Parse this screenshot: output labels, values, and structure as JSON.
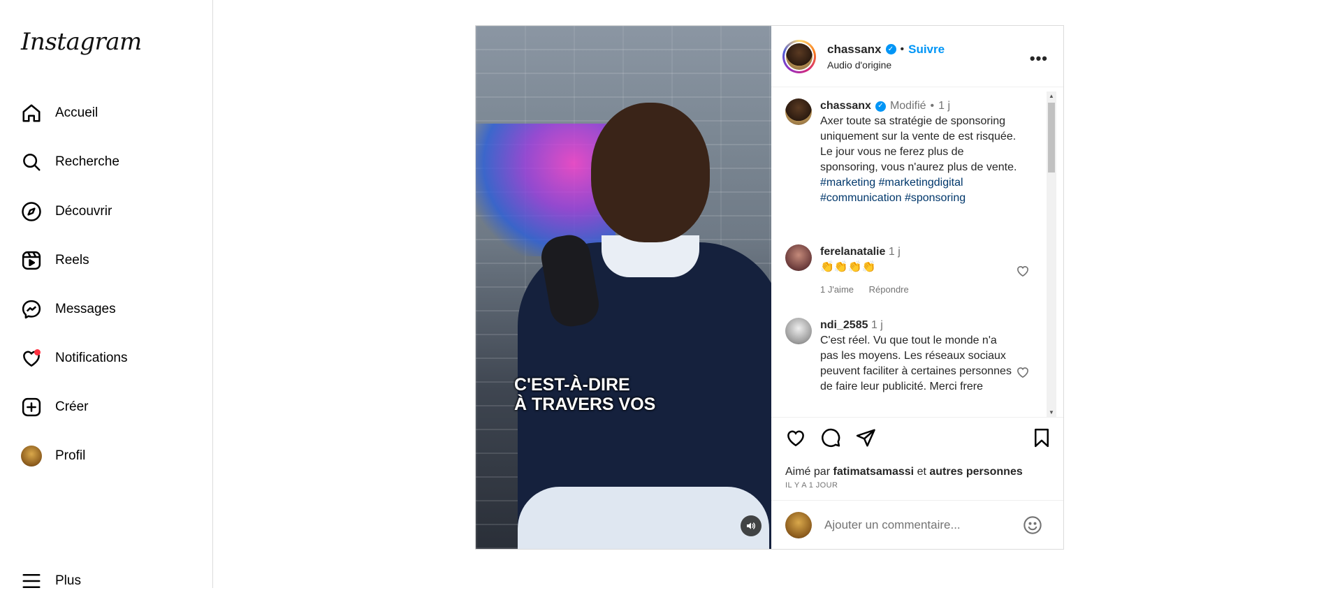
{
  "brand": {
    "logo_text": "Instagram"
  },
  "sidebar": {
    "items": [
      {
        "label": "Accueil",
        "icon": "home-icon"
      },
      {
        "label": "Recherche",
        "icon": "search-icon"
      },
      {
        "label": "Découvrir",
        "icon": "compass-icon"
      },
      {
        "label": "Reels",
        "icon": "reels-icon"
      },
      {
        "label": "Messages",
        "icon": "messenger-icon"
      },
      {
        "label": "Notifications",
        "icon": "heart-icon"
      },
      {
        "label": "Créer",
        "icon": "plus-square-icon"
      },
      {
        "label": "Profil",
        "icon": "avatar"
      },
      {
        "label": "Plus",
        "icon": "menu-icon"
      }
    ]
  },
  "post": {
    "media_caption_line1": "C'EST-À-DIRE",
    "media_caption_line2": "À TRAVERS VOS",
    "author": "chassanx",
    "follow_label": "Suivre",
    "separator": "•",
    "audio": "Audio d'origine",
    "caption": {
      "author": "chassanx",
      "edited": "Modifié",
      "dot": "•",
      "time": "1 j",
      "text": "Axer toute sa stratégie de sponsoring uniquement sur la vente de est risquée. Le jour vous ne ferez plus de sponsoring, vous n'aurez plus de vente.",
      "hashtags_line1": "#marketing #marketingdigital",
      "hashtags_line2": "#communication #sponsoring"
    },
    "comments": [
      {
        "user": "ferelanatalie",
        "time": "1 j",
        "text": "👏👏👏👏",
        "likes": "1 J'aime",
        "reply": "Répondre"
      },
      {
        "user": "ndi_2585",
        "time": "1 j",
        "text": "C'est réel. Vu que tout le monde n'a pas les moyens. Les réseaux sociaux peuvent faciliter à certaines personnes de faire leur publicité. Merci frere"
      }
    ],
    "liked_by_prefix": "Aimé par",
    "liked_by_user": "fatimatsamassi",
    "liked_by_and": "et",
    "liked_by_others": "autres personnes",
    "posted_ago": "IL Y A 1 JOUR",
    "add_comment_placeholder": "Ajouter un commentaire..."
  },
  "colors": {
    "accent": "#0095f6",
    "notification": "#ff3040",
    "hashtag": "#00376b"
  }
}
